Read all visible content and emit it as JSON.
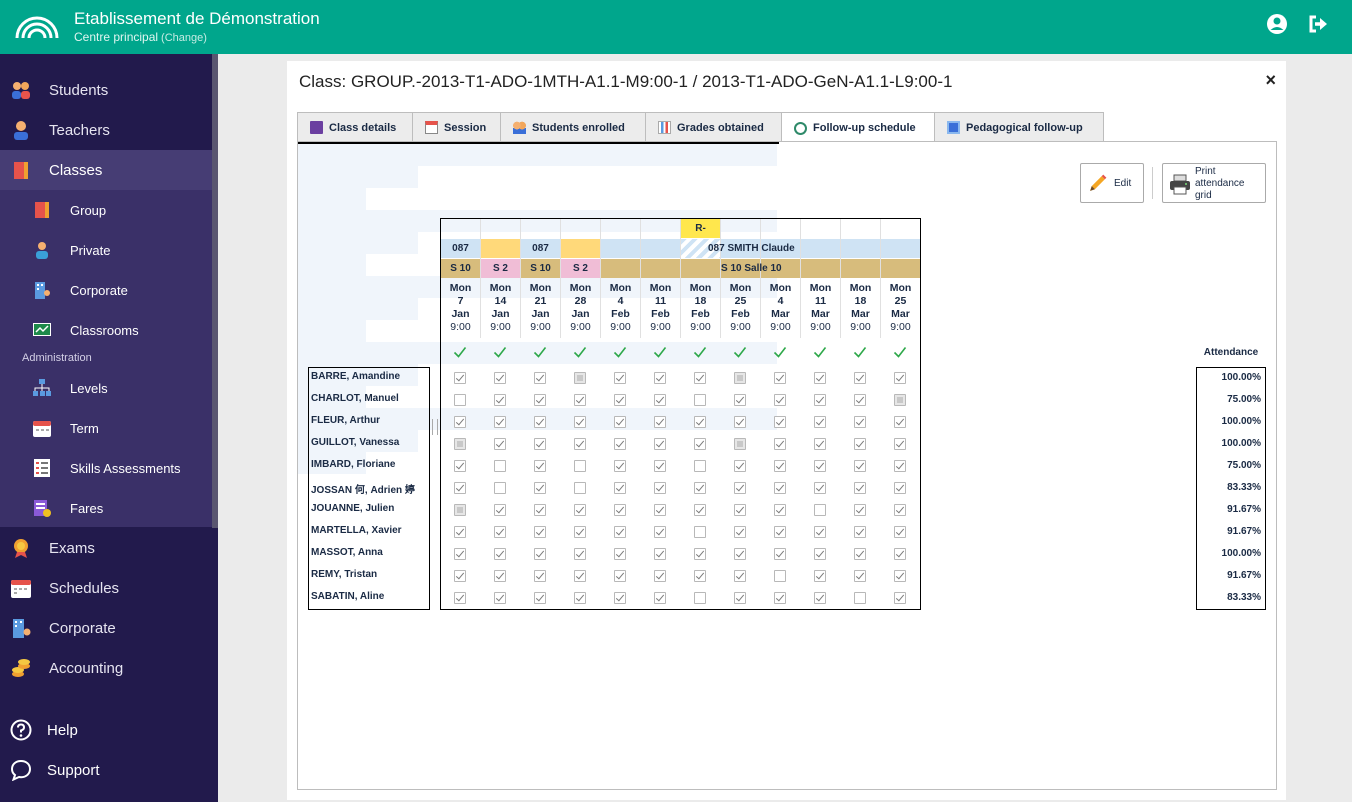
{
  "header": {
    "org_name": "Etablissement de Démonstration",
    "org_sub": "Centre principal",
    "change_label": "(Change)"
  },
  "sidebar": {
    "items": [
      {
        "label": "Students",
        "icon": "students-icon"
      },
      {
        "label": "Teachers",
        "icon": "teacher-icon"
      },
      {
        "label": "Classes",
        "icon": "book-icon"
      }
    ],
    "sub_items": [
      {
        "label": "Group",
        "icon": "book-icon"
      },
      {
        "label": "Private",
        "icon": "person-icon"
      },
      {
        "label": "Corporate",
        "icon": "building-icon"
      },
      {
        "label": "Classrooms",
        "icon": "whiteboard-icon"
      }
    ],
    "admin_header": "Administration",
    "admin_items": [
      {
        "label": "Levels",
        "icon": "hierarchy-icon"
      },
      {
        "label": "Term",
        "icon": "calendar-icon"
      },
      {
        "label": "Skills Assessments",
        "icon": "checklist-icon"
      },
      {
        "label": "Fares",
        "icon": "fares-icon"
      }
    ],
    "lower_items": [
      {
        "label": "Exams",
        "icon": "medal-icon"
      },
      {
        "label": "Schedules",
        "icon": "calendar-icon"
      },
      {
        "label": "Corporate",
        "icon": "building-icon"
      },
      {
        "label": "Accounting",
        "icon": "coins-icon"
      }
    ],
    "bottom_items": [
      {
        "label": "Help",
        "icon": "help-icon"
      },
      {
        "label": "Support",
        "icon": "chat-icon"
      }
    ]
  },
  "panel": {
    "title": "Class: GROUP.-2013-T1-ADO-1MTH-A1.1-M9:00-1 / 2013-T1-ADO-GeN-A1.1-L9:00-1",
    "close": "×"
  },
  "tabs": [
    {
      "label": "Class details",
      "icon": "class-icon"
    },
    {
      "label": "Session",
      "icon": "session-icon"
    },
    {
      "label": "Students enrolled",
      "icon": "students-icon"
    },
    {
      "label": "Grades obtained",
      "icon": "grades-icon"
    },
    {
      "label": "Follow-up schedule",
      "icon": "followup-icon",
      "active": true
    },
    {
      "label": "Pedagogical follow-up",
      "icon": "pedagogy-icon"
    }
  ],
  "buttons": {
    "edit": "Edit",
    "print_line1": "Print",
    "print_line2": "attendance",
    "print_line3": "grid"
  },
  "schedule": {
    "row1": [
      "",
      "",
      "",
      "",
      "",
      "",
      "R-",
      "",
      "",
      "",
      "",
      ""
    ],
    "teacher_cells": [
      "087",
      "",
      "087",
      "",
      "",
      "",
      "087 SMITH Claude",
      "",
      "",
      "",
      "",
      ""
    ],
    "room_cells": [
      "S 10",
      "S 2",
      "S 10",
      "S 2",
      "",
      "",
      "S 10 Salle 10",
      "",
      "",
      "",
      "",
      ""
    ],
    "dates": [
      [
        "Mon",
        "7",
        "Jan",
        "9:00"
      ],
      [
        "Mon",
        "14",
        "Jan",
        "9:00"
      ],
      [
        "Mon",
        "21",
        "Jan",
        "9:00"
      ],
      [
        "Mon",
        "28",
        "Jan",
        "9:00"
      ],
      [
        "Mon",
        "4",
        "Feb",
        "9:00"
      ],
      [
        "Mon",
        "11",
        "Feb",
        "9:00"
      ],
      [
        "Mon",
        "18",
        "Feb",
        "9:00"
      ],
      [
        "Mon",
        "25",
        "Feb",
        "9:00"
      ],
      [
        "Mon",
        "4",
        "Mar",
        "9:00"
      ],
      [
        "Mon",
        "11",
        "Mar",
        "9:00"
      ],
      [
        "Mon",
        "18",
        "Mar",
        "9:00"
      ],
      [
        "Mon",
        "25",
        "Mar",
        "9:00"
      ]
    ],
    "colors": {
      "teacher_bg": "#cfe3f4",
      "yellow": "#ffd97a",
      "pink": "#f0bdd6",
      "room_bg": "#d7bc7c",
      "r_bg": "#ffe74d"
    }
  },
  "attendance_header": "Attendance",
  "students": [
    {
      "name": "BARRE, Amandine",
      "pct": "100.00%",
      "marks": "cccdcccdcccc"
    },
    {
      "name": "CHARLOT, Manuel",
      "pct": "75.00%",
      "marks": "uccccceccccd"
    },
    {
      "name": "FLEUR, Arthur",
      "pct": "100.00%",
      "marks": "cccccccccccc"
    },
    {
      "name": "GUILLOT, Vanessa",
      "pct": "100.00%",
      "marks": "dccccccdcccc"
    },
    {
      "name": "IMBARD, Floriane",
      "pct": "75.00%",
      "marks": "cucuccucccc"
    },
    {
      "name": "JOSSAN 何, Adrien 婷",
      "pct": "83.33%",
      "marks": "cucucccccccc"
    },
    {
      "name": "JOUANNE, Julien",
      "pct": "91.67%",
      "marks": "dccccccccucc"
    },
    {
      "name": "MARTELLA, Xavier",
      "pct": "91.67%",
      "marks": "ccccccuccccc"
    },
    {
      "name": "MASSOT, Anna",
      "pct": "100.00%",
      "marks": "cccccccccccc"
    },
    {
      "name": "REMY, Tristan",
      "pct": "91.67%",
      "marks": "ccccccccuccc"
    },
    {
      "name": "SABATIN, Aline",
      "pct": "83.33%",
      "marks": "ccccccucccuc"
    }
  ]
}
